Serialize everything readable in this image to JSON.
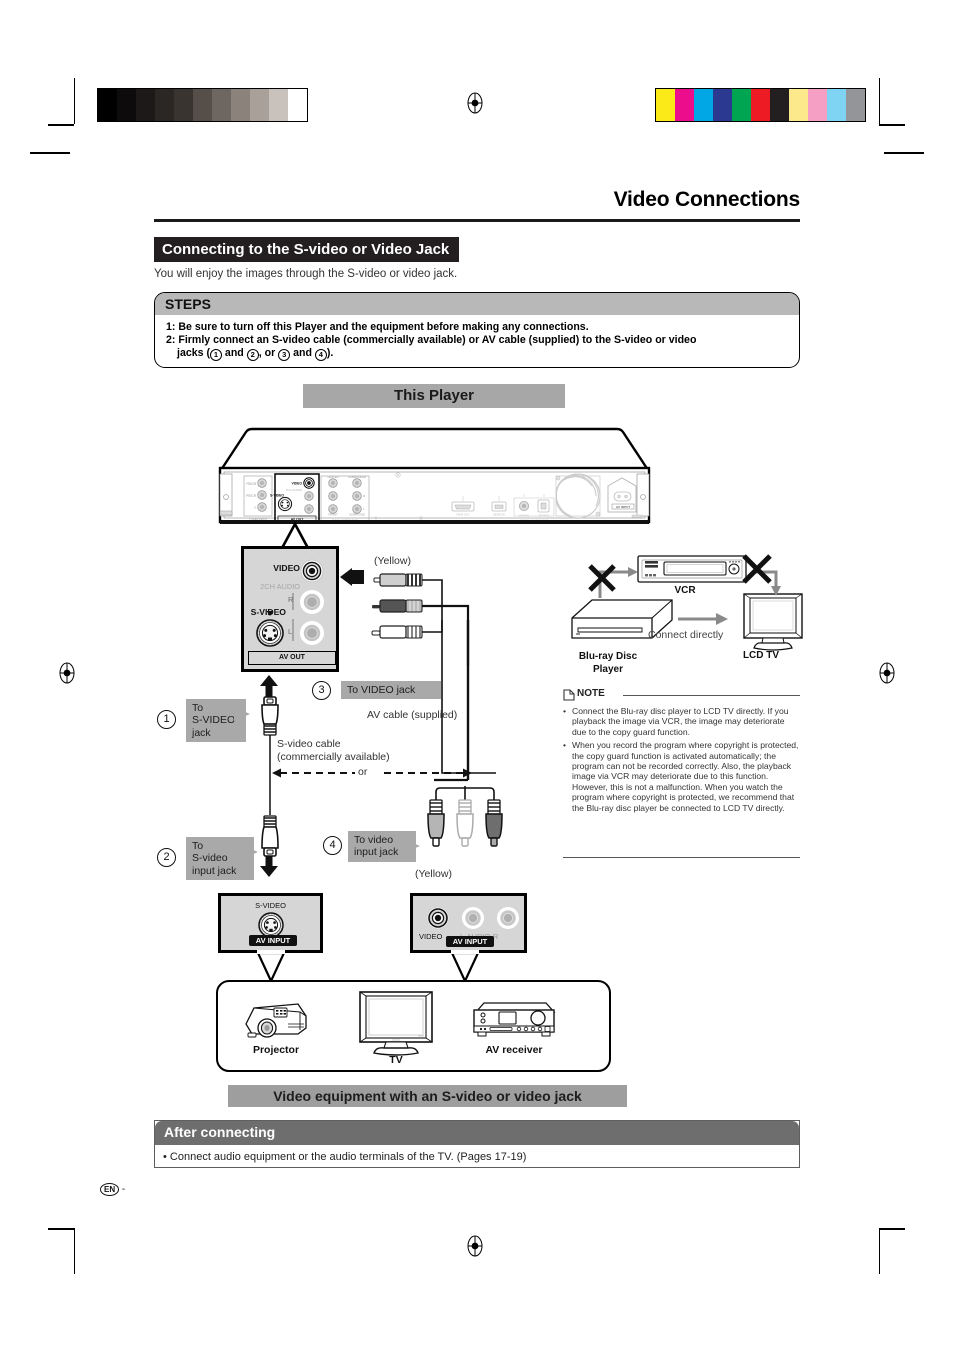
{
  "page": {
    "title": "Video Connections",
    "footer_mark": "EN",
    "footer_dash": "-"
  },
  "section": {
    "banner": "Connecting to the S-video or Video Jack",
    "intro": "You will enjoy the images through the S-video or video jack."
  },
  "steps": {
    "heading": "STEPS",
    "step1": "1: Be sure to turn off this Player and the equipment before making any connections.",
    "step2_a": "2: Firmly connect an S-video cable (commercially available) or AV cable (supplied) to the S-video or video",
    "step2_b_pre": "jacks (",
    "step2_b_mid": " and ",
    "step2_b_or": ", or ",
    "step2_b_and": " and ",
    "step2_b_end": ").",
    "num1": "1",
    "num2": "2",
    "num3": "3",
    "num4": "4"
  },
  "player": {
    "banner": "This Player",
    "rear_labels": {
      "component": "COMPONENT VIDEO OUT",
      "pb": "PB/CB",
      "pr": "PR/CR",
      "y": "Y",
      "avout": "AV OUT",
      "audioout": "7.1CH AUDIO OUT",
      "hdmi": "HDMI OUT",
      "service": "SERVICE",
      "coaxial": "COAXIAL",
      "optical": "OPTICAL",
      "digital": "DIGITAL AUDIO OUT",
      "ac": "AC INPUT"
    }
  },
  "avout_panel": {
    "video": "VIDEO",
    "audio": "2CH AUDIO",
    "svideo": "S-VIDEO",
    "r": "R",
    "l": "L",
    "tag": "AV OUT"
  },
  "callouts": {
    "c1": {
      "num": "1",
      "label": "To\nS-VIDEO\njack"
    },
    "c2": {
      "num": "2",
      "label": "To\nS-video\ninput jack"
    },
    "c3": {
      "num": "3",
      "label": "To VIDEO jack"
    },
    "c4": {
      "num": "4",
      "label": "To video\ninput jack"
    }
  },
  "cables": {
    "yellow_top": "(Yellow)",
    "yellow_bottom": "(Yellow)",
    "av_cable": "AV cable (supplied)",
    "svideo_cable_l1": "S-video cable",
    "svideo_cable_l2": "(commercially available)",
    "or": "or"
  },
  "avinput_svideo": {
    "caption": "S-VIDEO",
    "tag": "AV INPUT"
  },
  "avinput_rca": {
    "video": "VIDEO",
    "audio": "L-AUDIO-R",
    "tag": "AV INPUT"
  },
  "equipment": {
    "projector": "Projector",
    "tv": "TV",
    "av_receiver": "AV receiver",
    "banner": "Video equipment with an S-video or video jack"
  },
  "copyguard": {
    "vcr": "VCR",
    "blu_l1": "Blu-ray Disc",
    "blu_l2": "Player",
    "lcd": "LCD TV",
    "connect_directly": "Connect directly"
  },
  "note": {
    "heading": "NOTE",
    "items": [
      "Connect the Blu-ray disc player to LCD TV directly. If you playback the image via VCR, the image may deteriorate due to the copy guard function.",
      "When you record the program where copyright is protected, the copy guard function is activated automatically; the program can not be recorded correctly. Also, the playback image via VCR may deteriorate due to this function. However, this is not a malfunction. When you watch the program where copyright is protected, we recommend that the Blu-ray disc player be connected to LCD TV directly."
    ]
  },
  "after": {
    "heading": "After connecting",
    "body": "• Connect audio equipment or the audio terminals of the TV. (Pages 17-19)"
  },
  "printmarks": {
    "grayscale": [
      "#000000",
      "#0d0b0b",
      "#1c1918",
      "#2b2725",
      "#3a3431",
      "#554e49",
      "#6e6660",
      "#8b827c",
      "#a9a09a",
      "#c8c1bc",
      "#ffffff"
    ],
    "colors": [
      "#fcea18",
      "#ec0d8c",
      "#00a7e4",
      "#2b3990",
      "#00a551",
      "#ed1c24",
      "#231f20",
      "#fbe98b",
      "#f69fc4",
      "#7fd3f3",
      "#939598"
    ]
  }
}
